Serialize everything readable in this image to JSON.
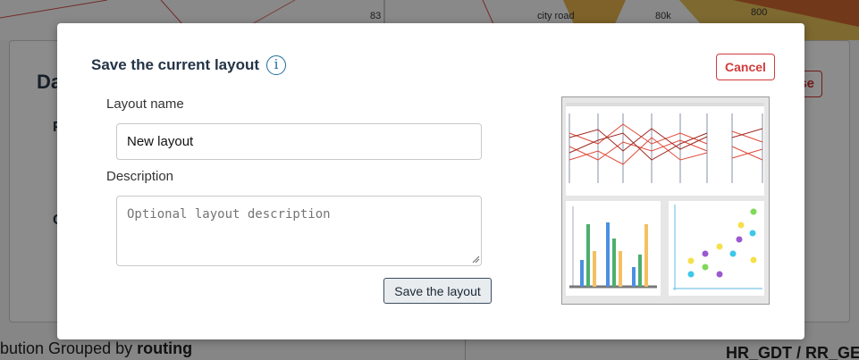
{
  "background": {
    "map_labels": {
      "label_83": "83",
      "city_road": "city road",
      "label_80k": "80k",
      "label_800": "800"
    },
    "panel_title_fragment": "Da",
    "letter_1": "F",
    "letter_2": "C",
    "close_fragment": "se",
    "bottom_left_prefix": "bution Grouped by ",
    "bottom_left_bold": "routing",
    "bottom_right": "HR_GDT / RR_GE"
  },
  "modal": {
    "title": "Save the current layout",
    "info_icon_glyph": "i",
    "cancel_label": "Cancel",
    "layout_name_label": "Layout name",
    "layout_name_value": "New layout",
    "description_label": "Description",
    "description_placeholder": "Optional layout description",
    "save_label": "Save the layout",
    "preview_icon": "layout-preview-thumbnail"
  },
  "colors": {
    "title": "#243447",
    "cancel": "#d23b3b",
    "info": "#1a6b9a"
  }
}
